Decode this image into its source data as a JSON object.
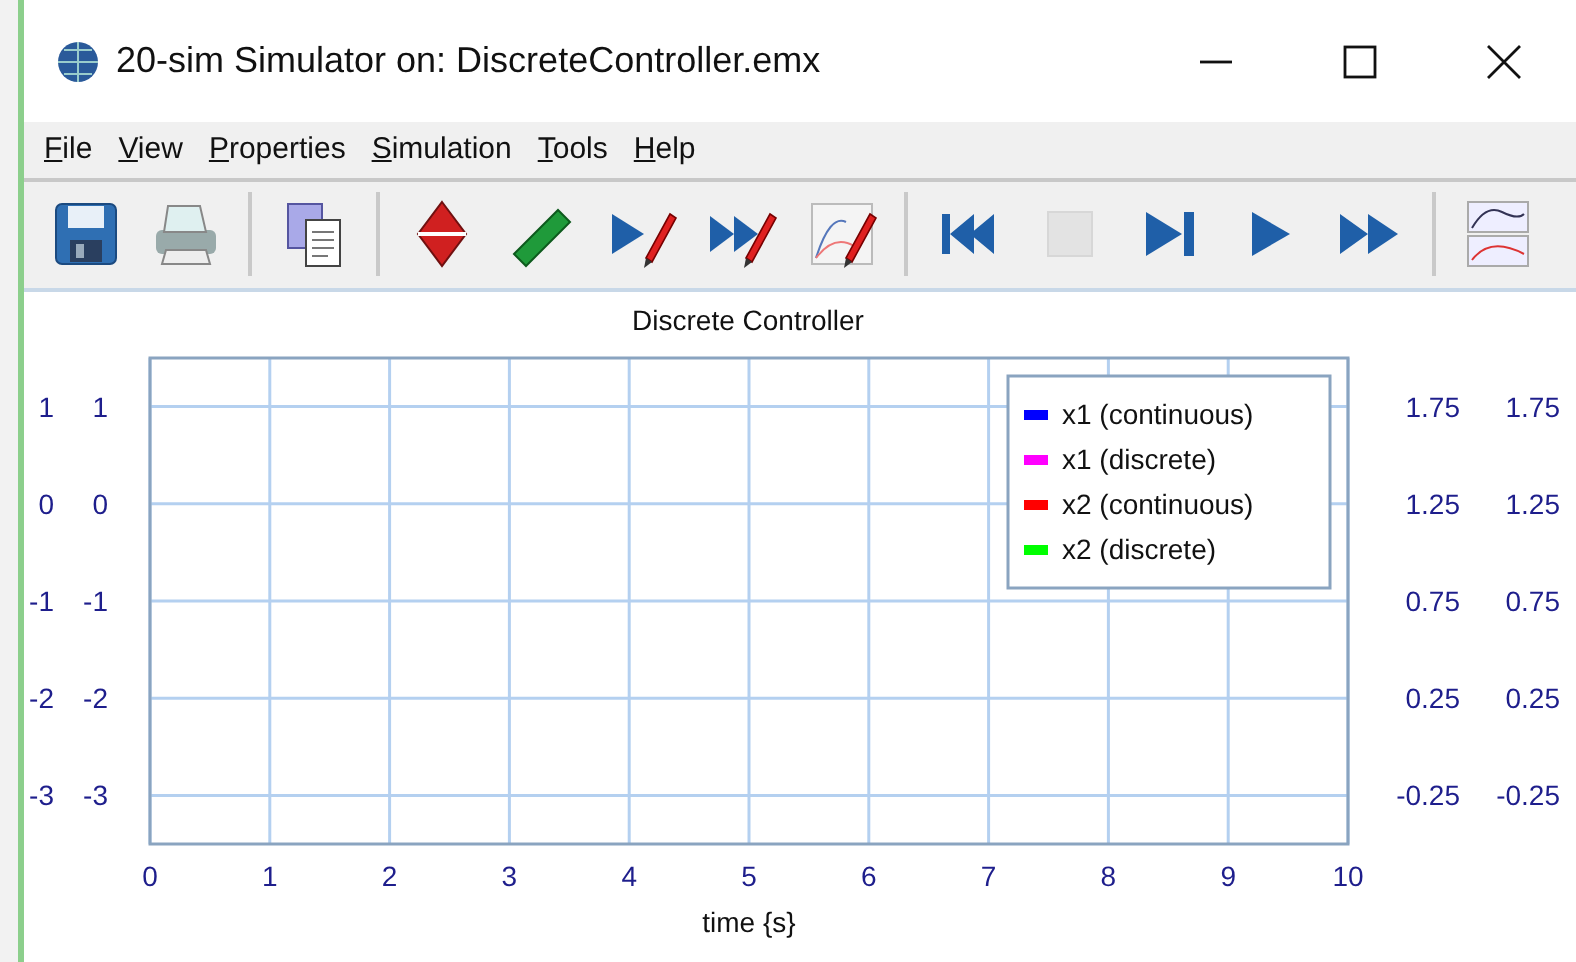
{
  "window": {
    "title": "20-sim Simulator on: DiscreteController.emx"
  },
  "menu": [
    {
      "label": "File"
    },
    {
      "label": "View"
    },
    {
      "label": "Properties"
    },
    {
      "label": "Simulation"
    },
    {
      "label": "Tools"
    },
    {
      "label": "Help"
    }
  ],
  "toolbar": {
    "buttons": [
      {
        "disabled": false
      },
      {
        "disabled": false
      },
      {
        "disabled": false
      },
      {
        "disabled": false
      },
      {
        "disabled": false
      },
      {
        "disabled": false
      },
      {
        "disabled": false
      },
      {
        "disabled": false
      },
      {
        "disabled": false
      },
      {
        "disabled": true
      },
      {
        "disabled": false
      },
      {
        "disabled": false
      },
      {
        "disabled": false
      },
      {
        "disabled": false
      }
    ]
  },
  "plot": {
    "chart_data": {
      "type": "line",
      "title": "Discrete Controller",
      "xlabel": "time {s}",
      "grid": true,
      "categories": [
        "0",
        "1",
        "2",
        "3",
        "4",
        "5",
        "6",
        "7",
        "8",
        "9",
        "10"
      ],
      "ylim": [
        -3.5,
        1.5
      ],
      "yticks": [
        {
          "value": 1,
          "label": "1"
        },
        {
          "value": 0,
          "label": "0"
        },
        {
          "value": -1,
          "label": "-1"
        },
        {
          "value": -2,
          "label": "-2"
        },
        {
          "value": -3,
          "label": "-3"
        }
      ],
      "series": [
        {
          "name": "x1 (continuous)",
          "color": "#0000ff",
          "values": [
            null,
            null,
            null,
            null,
            null,
            null,
            null,
            null,
            null,
            null,
            null
          ]
        },
        {
          "name": "x1 (discrete)",
          "color": "#ff00ff",
          "values": [
            null,
            null,
            null,
            null,
            null,
            null,
            null,
            null,
            null,
            null,
            null
          ]
        },
        {
          "name": "x2 (continuous)",
          "color": "#ff0000",
          "values": [
            null,
            null,
            null,
            null,
            null,
            null,
            null,
            null,
            null,
            null,
            null
          ]
        },
        {
          "name": "x2 (discrete)",
          "color": "#00ff00",
          "values": [
            null,
            null,
            null,
            null,
            null,
            null,
            null,
            null,
            null,
            null,
            null
          ]
        }
      ]
    },
    "outer_left_axis": {
      "ticks": [
        "1",
        "0",
        "-1",
        "-2",
        "-3"
      ]
    },
    "right_axes": [
      {
        "ticks": [
          "1.75",
          "1.25",
          "0.75",
          "0.25",
          "-0.25"
        ]
      },
      {
        "ticks": [
          "1.75",
          "1.25",
          "0.75",
          "0.25",
          "-0.25"
        ]
      }
    ]
  }
}
